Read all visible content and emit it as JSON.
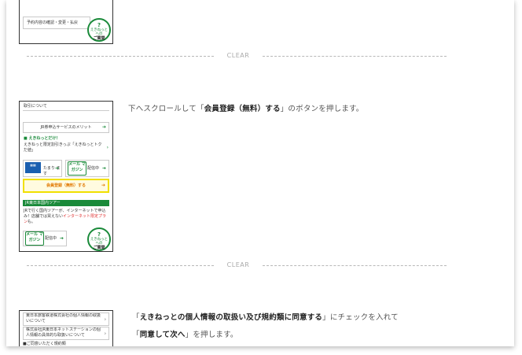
{
  "dividers": [
    "CLEAR",
    "CLEAR"
  ],
  "step1": {
    "shot_link": "予約内容の確認・変更・払戻",
    "badge_small": "えきねっとへの",
    "badge_big": "ご質問"
  },
  "step2": {
    "shot": {
      "top_text": "取引について",
      "merit_link": "JR券申込サービスのメリット",
      "ekinet_head": "えきねっとだけ！",
      "ekinet_text": "えきねっと限定割引きっぷ「えきねっとトクだ値」",
      "tablet_label": "たまり ます",
      "mag1": "メール マガジン",
      "mag1_label": "配信中",
      "register": "会員登録（無料）する",
      "tour_head": "JR東日本国内ツアー",
      "tour_text1": "JRで行く国内ツアーが、インターネットで申込",
      "tour_text2": "み！店舗では買えない",
      "tour_red": "インターネット限定プラン",
      "tour_text3": "も。",
      "mag2": "メール マガジン",
      "mag2_label": "配信中",
      "badge_small": "えきねっとへの",
      "badge_big": "ご質問"
    },
    "desc_pre": "下へスクロールして「",
    "desc_bold": "会員登録（無料）する",
    "desc_post": "」のボタンを押します。"
  },
  "step3": {
    "shot": {
      "line1": "東日本旅客鉄道株式会社の個人情報の取扱いについて",
      "line2": "株式会社JR東日本ネットステーションの個人情報の具体的な取扱いについて",
      "line3": "ご同意いただく規約類"
    },
    "desc_pre": "「",
    "desc_bold1": "えきねっとの個人情報の取扱い及び規約類に同意する",
    "desc_mid": "」にチェックを入れて",
    "desc_pre2": "「",
    "desc_bold2": "同意して次へ",
    "desc_post2": "」を押します。"
  }
}
